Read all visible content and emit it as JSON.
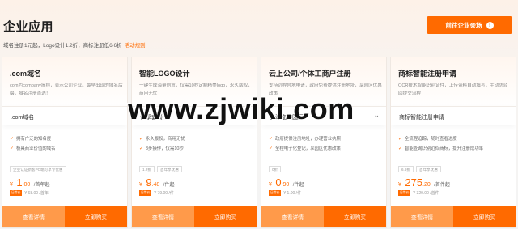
{
  "header": {
    "title": "企业应用",
    "subtitle": "域名注册1元起，Logo设计1.2折，商标注册低6.6折",
    "subtitle_link": "活动规则",
    "cta_label": "前往企业会场",
    "cta_icon": "arrow-right-icon"
  },
  "cards": [
    {
      "title": ".com域名",
      "desc": "com为company简称，表示公司企业。最早出现的域名后缀，域名注册首选！",
      "selector": ".com域名",
      "has_chevron": false,
      "features": [
        "拥有广泛的知名度",
        "极具商业价值的域名"
      ],
      "tags": [
        "企业认证新客PC端可享专优惠"
      ],
      "price": "1",
      "price_decimals": ".00",
      "price_unit": "/首年起",
      "badge": "日常价",
      "old_price": "¥ 68.00 /首年"
    },
    {
      "title": "智能LOGO设计",
      "desc": "一键生成海量创意，仅需10秒定制精美logo，永久版权，商用无忧",
      "selector": "优享套餐",
      "has_chevron": true,
      "features": [
        "永久版权，商用无忧",
        "3步操作，仅需10秒"
      ],
      "tags": [
        "1.2折",
        "首年享优惠"
      ],
      "price": "9",
      "price_decimals": ".48",
      "price_unit": "/件起",
      "badge": "日常价",
      "old_price": "¥ 79.00 /件"
    },
    {
      "title": "云上公司/个体工商户注册",
      "desc": "支持远程异地申请，政府免费提供注册地址，享园区优惠政策",
      "selector": "上海临港园区",
      "has_chevron": true,
      "features": [
        "政府提供注册地址，办理营业执照",
        "全程电子化登记，享园区优惠政策"
      ],
      "tags": [
        "0折"
      ],
      "price": "0",
      "price_decimals": ".90",
      "price_unit": "/件起",
      "badge": "日常价",
      "old_price": "¥ 1.00 /件"
    },
    {
      "title": "商标智能注册申请",
      "desc": "OCR技术智能识别证件，上传资料自动填写，主动防驳回提交流程",
      "selector": "商标智能注册申请",
      "has_chevron": false,
      "features": [
        "全流程追踪，随时查看进度",
        "智能查询识别近似商标，提升注册成功率"
      ],
      "tags": [
        "6.6折",
        "首年享优惠"
      ],
      "price": "275",
      "price_decimals": ".20",
      "price_unit": "/首件起",
      "badge": "日常价",
      "old_price": "¥ 320.00 /首件"
    }
  ],
  "buttons": {
    "detail": "查看详情",
    "buy": "立即购买"
  },
  "currency": "¥",
  "check_glyph": "✓",
  "chevron_glyph": "⌄",
  "watermark": "www.zjwiki.com",
  "colors": {
    "accent": "#ff6a00",
    "accent_light": "#ff9a4a"
  }
}
